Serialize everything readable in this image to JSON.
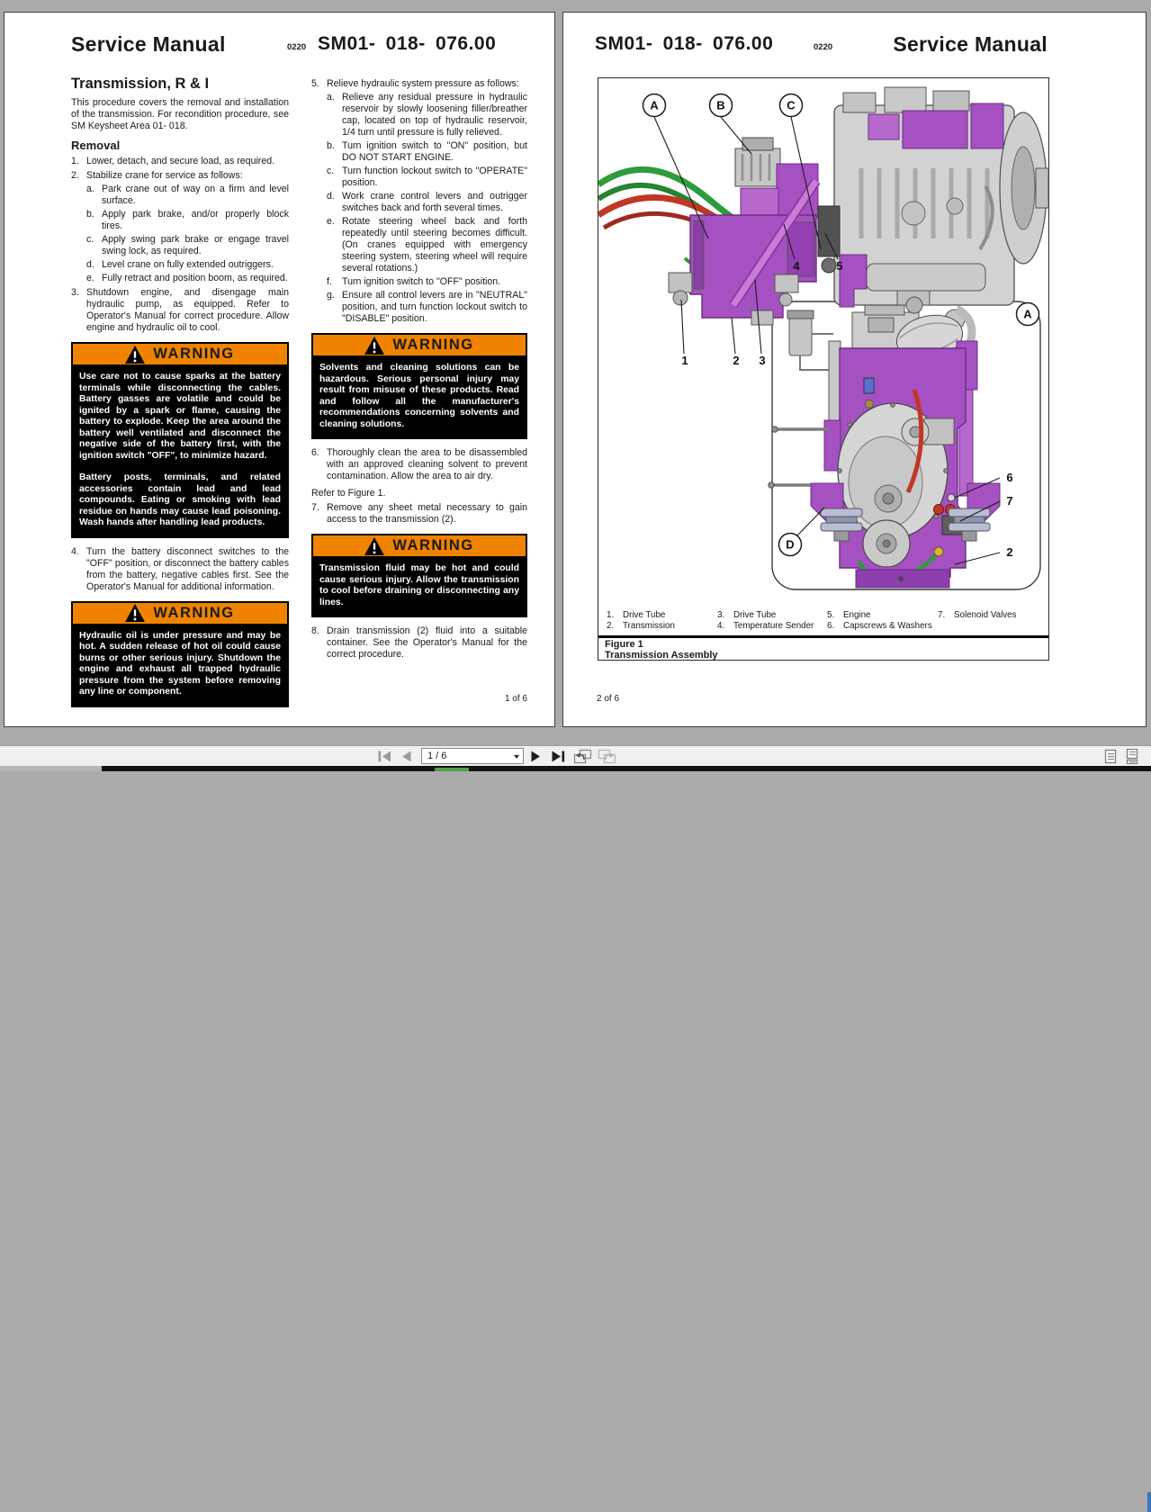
{
  "pdf": {
    "warning_label": "WARNING",
    "left_page": {
      "brand": "Service Manual",
      "rev": "0220",
      "doc_no": "SM01- 018- 076.00",
      "title": "Transmission, R & I",
      "intro": "This procedure covers the removal and installation of the transmission.  For recondition procedure, see SM Keysheet Area 01- 018.",
      "removal_heading": "Removal",
      "refer_note": "Refer to Figure 1.",
      "page_no": "1 of 6",
      "steps": [
        {
          "n": "1.",
          "t": "Lower, detach, and secure load, as required."
        },
        {
          "n": "2.",
          "t": "Stabilize crane for service as follows:",
          "subs": [
            {
              "n": "a.",
              "t": "Park crane out of way on a firm and level surface."
            },
            {
              "n": "b.",
              "t": "Apply park brake, and/or properly block tires."
            },
            {
              "n": "c.",
              "t": "Apply swing park brake or engage travel swing lock, as required."
            },
            {
              "n": "d.",
              "t": "Level crane on fully extended outriggers."
            },
            {
              "n": "e.",
              "t": "Fully retract and position boom, as required."
            }
          ]
        },
        {
          "n": "3.",
          "t": "Shutdown engine, and disengage main hydraulic pump, as equipped.  Refer to Operator's Manual for correct procedure.  Allow engine and hydraulic oil to cool."
        },
        {
          "n": "4.",
          "t": "Turn the battery disconnect switches to the \"OFF\" position, or disconnect the battery cables from the battery, negative cables first.  See the Operator's Manual for additional information."
        },
        {
          "n": "5.",
          "t": "Relieve hydraulic system pressure as follows:",
          "subs": [
            {
              "n": "a.",
              "t": "Relieve any residual pressure in hydraulic reservoir by slowly loosening filler/breather cap, located on top of hydraulic reservoir, 1/4 turn until pressure is fully relieved."
            },
            {
              "n": "b.",
              "t": "Turn ignition switch to \"ON\" position, but DO NOT START ENGINE."
            },
            {
              "n": "c.",
              "t": "Turn function lockout switch to \"OPERATE\" position."
            },
            {
              "n": "d.",
              "t": "Work crane control levers and outrigger switches back and forth several times."
            },
            {
              "n": "e.",
              "t": "Rotate steering wheel back and forth repeatedly until steering becomes difficult. (On cranes equipped with emergency steering system, steering wheel will require several rotations.)"
            },
            {
              "n": "f.",
              "t": "Turn ignition switch to \"OFF\" position."
            },
            {
              "n": "g.",
              "t": "Ensure all control levers are in \"NEUTRAL\" position, and turn function lockout switch to \"DISABLE\" position."
            }
          ]
        },
        {
          "n": "6.",
          "t": "Thoroughly clean the area to be disassembled with an approved cleaning solvent to prevent contamination.  Allow the area to air dry."
        },
        {
          "n": "7.",
          "t": "Remove any sheet metal necessary to gain access to the transmission (2)."
        },
        {
          "n": "8.",
          "t": "Drain transmission (2) fluid into a suitable container.  See the Operator's Manual for the correct procedure."
        }
      ],
      "warnings": {
        "battery_p1": "Use care not to cause sparks at the battery terminals while disconnecting the cables.  Battery gasses are volatile and could be ignited by a spark or flame, causing the battery to explode.  Keep the area around the battery well ventilated and disconnect the negative side of the battery first, with the ignition switch \"OFF\", to minimize hazard.",
        "battery_p2": "Battery posts, terminals, and related accessories contain lead and lead compounds.  Eating or smoking with lead residue on hands may cause lead poisoning.  Wash hands after handling lead products.",
        "hydraulic": "Hydraulic oil is under pressure and may be hot.  A sudden release of hot oil could cause burns or other serious injury.  Shutdown the engine and exhaust all trapped hydraulic pressure from the system before removing any line or component.",
        "solvents": "Solvents and cleaning solutions can be hazardous.  Serious personal injury may result from misuse of these products.  Read and follow all the manufacturer's recommendations concerning solvents and cleaning solutions.",
        "fluid": "Transmission fluid may be hot and could cause serious injury.  Allow the transmission to cool before draining or disconnecting any lines."
      }
    },
    "right_page": {
      "brand": "Service Manual",
      "rev": "0220",
      "doc_no": "SM01- 018- 076.00",
      "page_no": "2 of 6",
      "figure": {
        "caption_no": "Figure 1",
        "caption_title": "Transmission Assembly",
        "callouts": {
          "A": "A",
          "B": "B",
          "C": "C",
          "D": "D",
          "n1": "1",
          "n2": "2",
          "n3": "3",
          "n4": "4",
          "n5": "5",
          "n6": "6",
          "n7": "7"
        },
        "legend": [
          {
            "n": "1.",
            "t": "Drive Tube"
          },
          {
            "n": "2.",
            "t": "Transmission"
          },
          {
            "n": "3.",
            "t": "Drive Tube"
          },
          {
            "n": "4.",
            "t": "Temperature Sender"
          },
          {
            "n": "5.",
            "t": "Engine"
          },
          {
            "n": "6.",
            "t": "Capscrews & Washers"
          },
          {
            "n": "7.",
            "t": "Solenoid Valves"
          }
        ]
      }
    },
    "toolbar": {
      "page_field": "1 / 6"
    },
    "colors": {
      "warning_orange": "#ef8300",
      "highlight_purple": "#a551c1",
      "hose_green": "#2e9c3c",
      "hose_red": "#c13727"
    }
  }
}
